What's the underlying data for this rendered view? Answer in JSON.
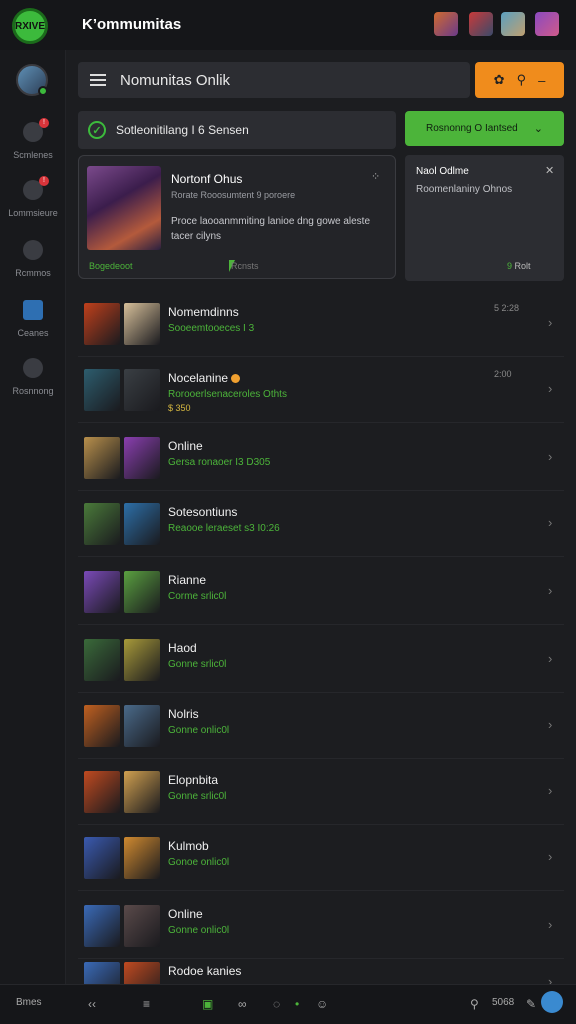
{
  "app": {
    "logo_text": "RXIVE",
    "title": "K’ommumitas"
  },
  "sidebar": {
    "items": [
      {
        "label": "Scmlenes",
        "icon": "notifications-icon",
        "badge": "!"
      },
      {
        "label": "Lommsieure",
        "icon": "friends-icon",
        "badge": "!"
      },
      {
        "label": "Rcmmos",
        "icon": "tools-icon",
        "badge": ""
      },
      {
        "label": "Ceanes",
        "icon": "chart-icon",
        "badge": ""
      },
      {
        "label": "Rosnnong",
        "icon": "chat-icon",
        "badge": ""
      }
    ]
  },
  "search": {
    "text": "Nomunitas Onlik"
  },
  "status": {
    "text": "Sotleonitilang I 6 Sensen",
    "button": "Rosnonng O Iantsed"
  },
  "featured": {
    "title": "Nortonf Ohus",
    "meta": "Rorate  Rooosumtent  9  poroere",
    "meta_count": "9",
    "description": "Proce laooanmmiting lanioe dng gowe aleste tacer cilyns",
    "footer_left": "Bogedeoot",
    "footer_right": "Rcnsts"
  },
  "panel": {
    "title": "Naol Odlme",
    "description": "Roomenlaniny Ohnos",
    "footer_icon": "9",
    "footer_text": "Rolt"
  },
  "list": [
    {
      "name": "Nomemdinns",
      "sub": "Sooeemtooeces I 3",
      "sub2": "",
      "meta": "5  2:28",
      "colors": [
        "#c0401c",
        "#d7c09a"
      ]
    },
    {
      "name": "Nocelanine",
      "sub": "Rorooerlsenaceroles Othts",
      "sub2": "$ 350",
      "meta": "2:00",
      "colors": [
        "#2d5d6e",
        "#3a3f44"
      ]
    },
    {
      "name": "Online",
      "sub": "Gersa ronaoer  I3 D305",
      "sub2": "",
      "meta": "",
      "colors": [
        "#b8904c",
        "#8a3fb0"
      ]
    },
    {
      "name": "Sotesontiuns",
      "sub": "Reaooe leraeset  s3 I0:26",
      "sub2": "",
      "meta": "",
      "colors": [
        "#4a7a3a",
        "#2d6fa8"
      ]
    },
    {
      "name": "Rianne",
      "sub": "Corme srlic0l",
      "sub2": "",
      "meta": "",
      "colors": [
        "#7a4ab8",
        "#5aa040"
      ]
    },
    {
      "name": "Haod",
      "sub": "Gonne srlic0l",
      "sub2": "",
      "meta": "",
      "colors": [
        "#3a6a3a",
        "#a89a3a"
      ]
    },
    {
      "name": "Nolris",
      "sub": "Gonne onlic0l",
      "sub2": "",
      "meta": "",
      "colors": [
        "#c06020",
        "#4a6a8a"
      ]
    },
    {
      "name": "Elopnbita",
      "sub": "Gonne srlic0l",
      "sub2": "",
      "meta": "",
      "colors": [
        "#c04a20",
        "#d0a050"
      ]
    },
    {
      "name": "Kulmob",
      "sub": "Gonoe onlic0l",
      "sub2": "",
      "meta": "",
      "colors": [
        "#3a5ab0",
        "#d08a30"
      ]
    },
    {
      "name": "Online",
      "sub": "Gonne onlic0l",
      "sub2": "",
      "meta": "",
      "colors": [
        "#3a6ab8",
        "#5a4a4a"
      ]
    },
    {
      "name": "Rodoe kanies",
      "sub": "",
      "sub2": "",
      "meta": "",
      "colors": [
        "#3a6ab8",
        "#c04a20"
      ]
    }
  ],
  "bottombar": {
    "left": "Bmes",
    "right": "5068"
  },
  "colors": {
    "accent_green": "#4cb43a",
    "accent_orange": "#f08c1c",
    "background": "#1c1d20"
  }
}
